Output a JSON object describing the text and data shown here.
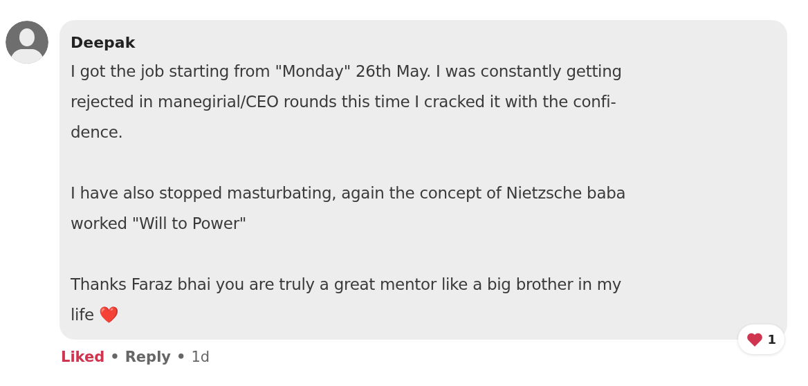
{
  "comment": {
    "author": "Deepak",
    "paragraphs": [
      {
        "lines": [
          "I got the job starting from \"Monday\" 26th May. I was constantly getting",
          "rejected in manegirial/CEO rounds this time I cracked it with the confi-",
          "dence."
        ]
      },
      {
        "lines": [
          "I have also stopped masturbating, again the concept of Nietzsche baba",
          "worked \"Will to Power\""
        ]
      },
      {
        "lines": [
          "Thanks Faraz bhai you are truly a great mentor like a big brother in my",
          "life ❤️"
        ]
      }
    ],
    "reaction_count": "1",
    "like": {
      "label": "Liked",
      "liked": true
    },
    "separators": [
      "•",
      "•"
    ],
    "reply": "Reply",
    "time": "1d"
  }
}
